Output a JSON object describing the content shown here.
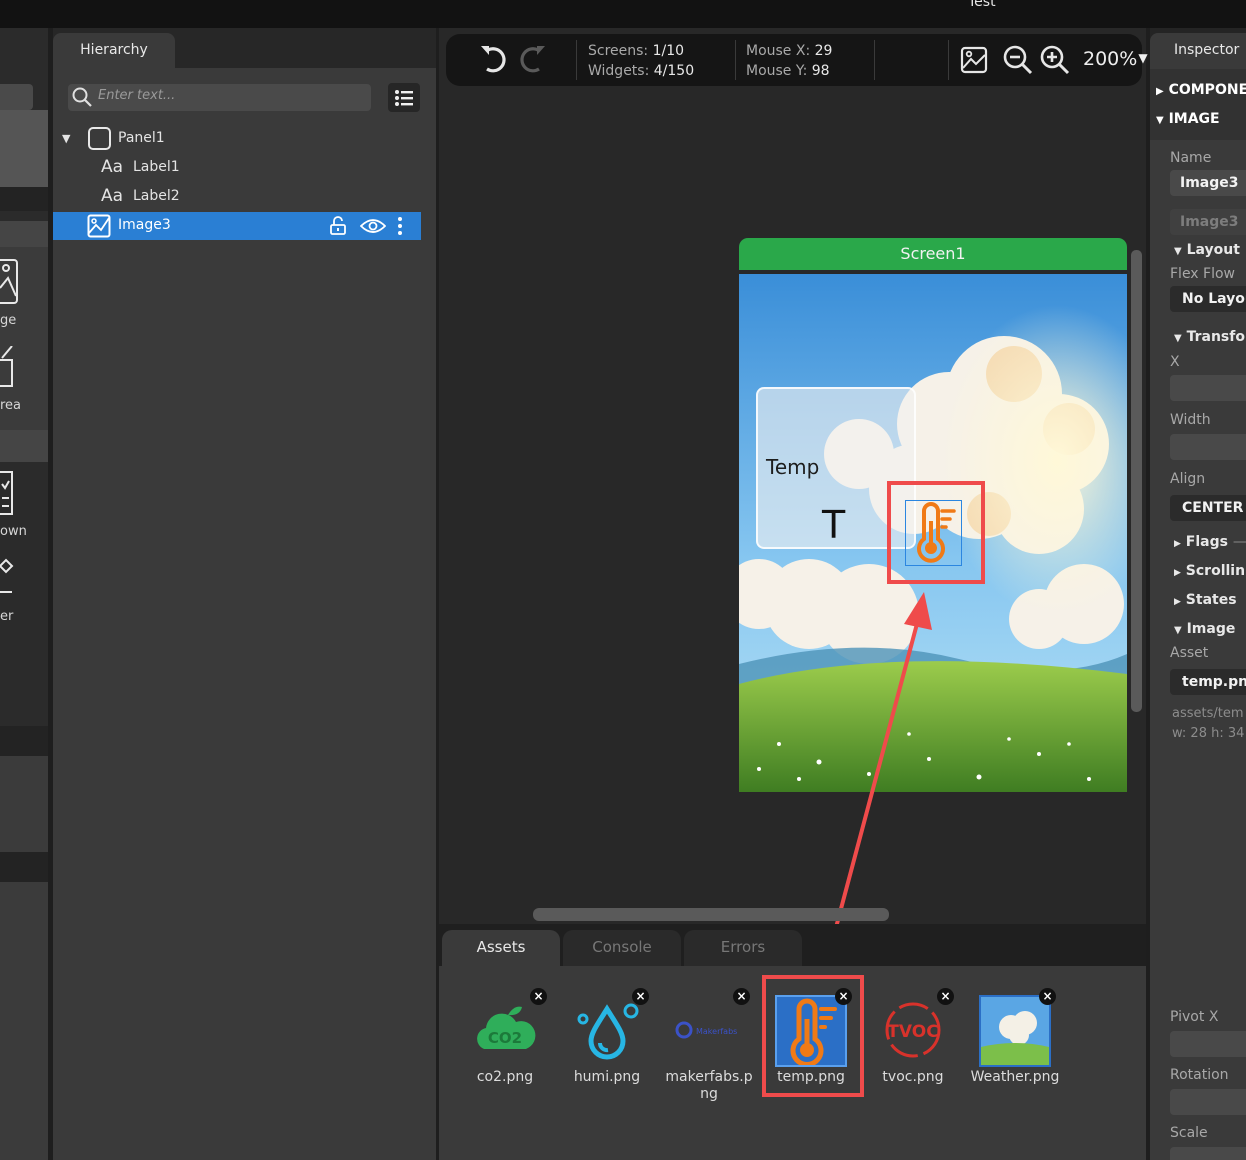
{
  "window": {
    "title": "Test"
  },
  "palette": {
    "labels": [
      "ge",
      "rea",
      "own",
      "er"
    ]
  },
  "hierarchy": {
    "tab_label": "Hierarchy",
    "search_placeholder": "Enter text...",
    "tree": [
      {
        "label": "Panel1",
        "type": "panel",
        "expanded": true
      },
      {
        "label": "Label1",
        "type": "label",
        "icon_text": "Aa"
      },
      {
        "label": "Label2",
        "type": "label",
        "icon_text": "Aa"
      },
      {
        "label": "Image3",
        "type": "image",
        "selected": true
      }
    ]
  },
  "toolbar": {
    "screens_label": "Screens:",
    "screens_value": "1/10",
    "widgets_label": "Widgets:",
    "widgets_value": "4/150",
    "mouse_x_label": "Mouse X:",
    "mouse_x_value": "29",
    "mouse_y_label": "Mouse Y:",
    "mouse_y_value": "98",
    "zoom": "200%"
  },
  "canvas": {
    "screen_title": "Screen1",
    "card_text": "Temp",
    "card_big_text": "T"
  },
  "bottom": {
    "tabs": [
      {
        "label": "Assets",
        "active": true
      },
      {
        "label": "Console",
        "active": false
      },
      {
        "label": "Errors",
        "active": false
      }
    ],
    "assets": [
      {
        "name": "co2.png",
        "icon_text": "CO2"
      },
      {
        "name": "humi.png"
      },
      {
        "name": "makerfabs.png",
        "icon_text": "Makerfabs"
      },
      {
        "name": "temp.png",
        "selected": true
      },
      {
        "name": "tvoc.png",
        "icon_text": "TVOC"
      },
      {
        "name": "Weather.png"
      }
    ],
    "remove_glyph": "×"
  },
  "inspector": {
    "tab_label": "Inspector",
    "section_components": "COMPONE",
    "section_image": "IMAGE",
    "name_label": "Name",
    "name_value": "Image3",
    "name_placeholder": "Image3",
    "layout_label": "Layout",
    "flex_flow_label": "Flex Flow",
    "flex_flow_value": "No Layou",
    "transform_label": "Transfo",
    "x_label": "X",
    "width_label": "Width",
    "align_label": "Align",
    "align_value": "CENTER",
    "flags_label": "Flags",
    "scrolling_label": "Scrollin",
    "states_label": "States",
    "image_label": "Image",
    "asset_label": "Asset",
    "asset_value": "temp.pn",
    "asset_path": "assets/tem",
    "asset_size": "w: 28  h: 34",
    "pivot_x_label": "Pivot X",
    "rotation_label": "Rotation",
    "scale_label": "Scale"
  },
  "colors": {
    "selection": "#2a7fd4",
    "screen_header": "#2aa84a",
    "annotation": "#ef4b4b",
    "temp_orange": "#f07a16",
    "temp_blue": "#2b6fc6"
  }
}
